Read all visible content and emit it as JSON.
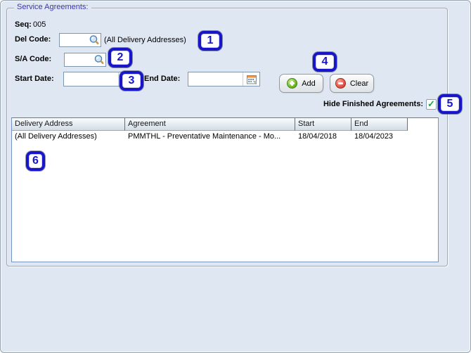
{
  "panel": {
    "title": "Service Agreements:"
  },
  "form": {
    "seq": {
      "label": "Seq:",
      "value": "005"
    },
    "del_code": {
      "label": "Del Code:",
      "value": "",
      "note": "(All Delivery Addresses)"
    },
    "sa_code": {
      "label": "S/A Code:",
      "value": ""
    },
    "start_date": {
      "label": "Start Date:",
      "value": ""
    },
    "end_date": {
      "label": "End Date:",
      "value": ""
    },
    "hide_finished": {
      "label": "Hide Finished Agreements:",
      "checked": true,
      "mark": "✓"
    }
  },
  "buttons": {
    "add": "Add",
    "clear": "Clear"
  },
  "table": {
    "columns": [
      "Delivery Address",
      "Agreement",
      "Start",
      "End"
    ],
    "rows": [
      {
        "delivery_address": "(All Delivery Addresses)",
        "agreement": "PMMTHL - Preventative Maintenance - Mo...",
        "start": "18/04/2018",
        "end": "18/04/2023"
      }
    ]
  },
  "annotations": {
    "badges": [
      "1",
      "2",
      "3",
      "4",
      "5",
      "6"
    ]
  },
  "colors": {
    "panel_bg": "#dfe8f2",
    "badge_blue": "#1717c9",
    "group_title_blue": "#3a36a6",
    "table_border": "#7695c2",
    "add_green": "#6db825",
    "clear_red": "#de5246",
    "check_green": "#23a33b"
  }
}
